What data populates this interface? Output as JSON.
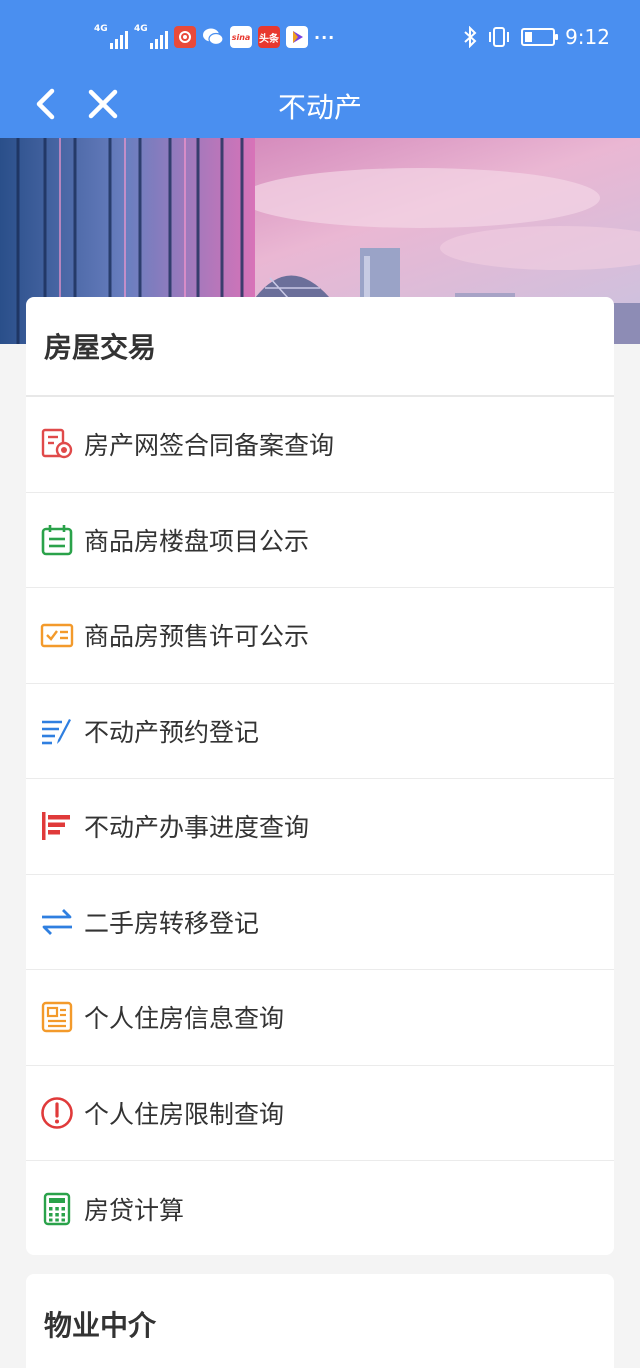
{
  "status_bar": {
    "network_1": "4G",
    "network_2": "4G",
    "app_icons": [
      "jingjing-icon",
      "wechat-icon",
      "sina-weibo-icon",
      "toutiao-icon",
      "video-icon"
    ],
    "sina_text": "sina",
    "toutiao_text": "头条",
    "more": "···",
    "time": "9:12",
    "battery_level": 0.25
  },
  "nav": {
    "title": "不动产"
  },
  "section_1": {
    "title": "房屋交易",
    "items": [
      {
        "label": "房产网签合同备案查询",
        "icon": "contract-record-icon",
        "color": "#e04a4a"
      },
      {
        "label": "商品房楼盘项目公示",
        "icon": "calendar-icon",
        "color": "#2aa24a"
      },
      {
        "label": "商品房预售许可公示",
        "icon": "presale-license-icon",
        "color": "#f39a2b"
      },
      {
        "label": "不动产预约登记",
        "icon": "edit-list-icon",
        "color": "#2f7fe0"
      },
      {
        "label": "不动产办事进度查询",
        "icon": "progress-bars-icon",
        "color": "#e03a3a"
      },
      {
        "label": "二手房转移登记",
        "icon": "transfer-arrows-icon",
        "color": "#2f7fe0"
      },
      {
        "label": "个人住房信息查询",
        "icon": "id-card-icon",
        "color": "#f39a2b"
      },
      {
        "label": "个人住房限制查询",
        "icon": "alert-circle-icon",
        "color": "#e03a3a"
      },
      {
        "label": "房贷计算",
        "icon": "calculator-icon",
        "color": "#2aa24a"
      }
    ]
  },
  "section_2": {
    "title": "物业中介"
  }
}
